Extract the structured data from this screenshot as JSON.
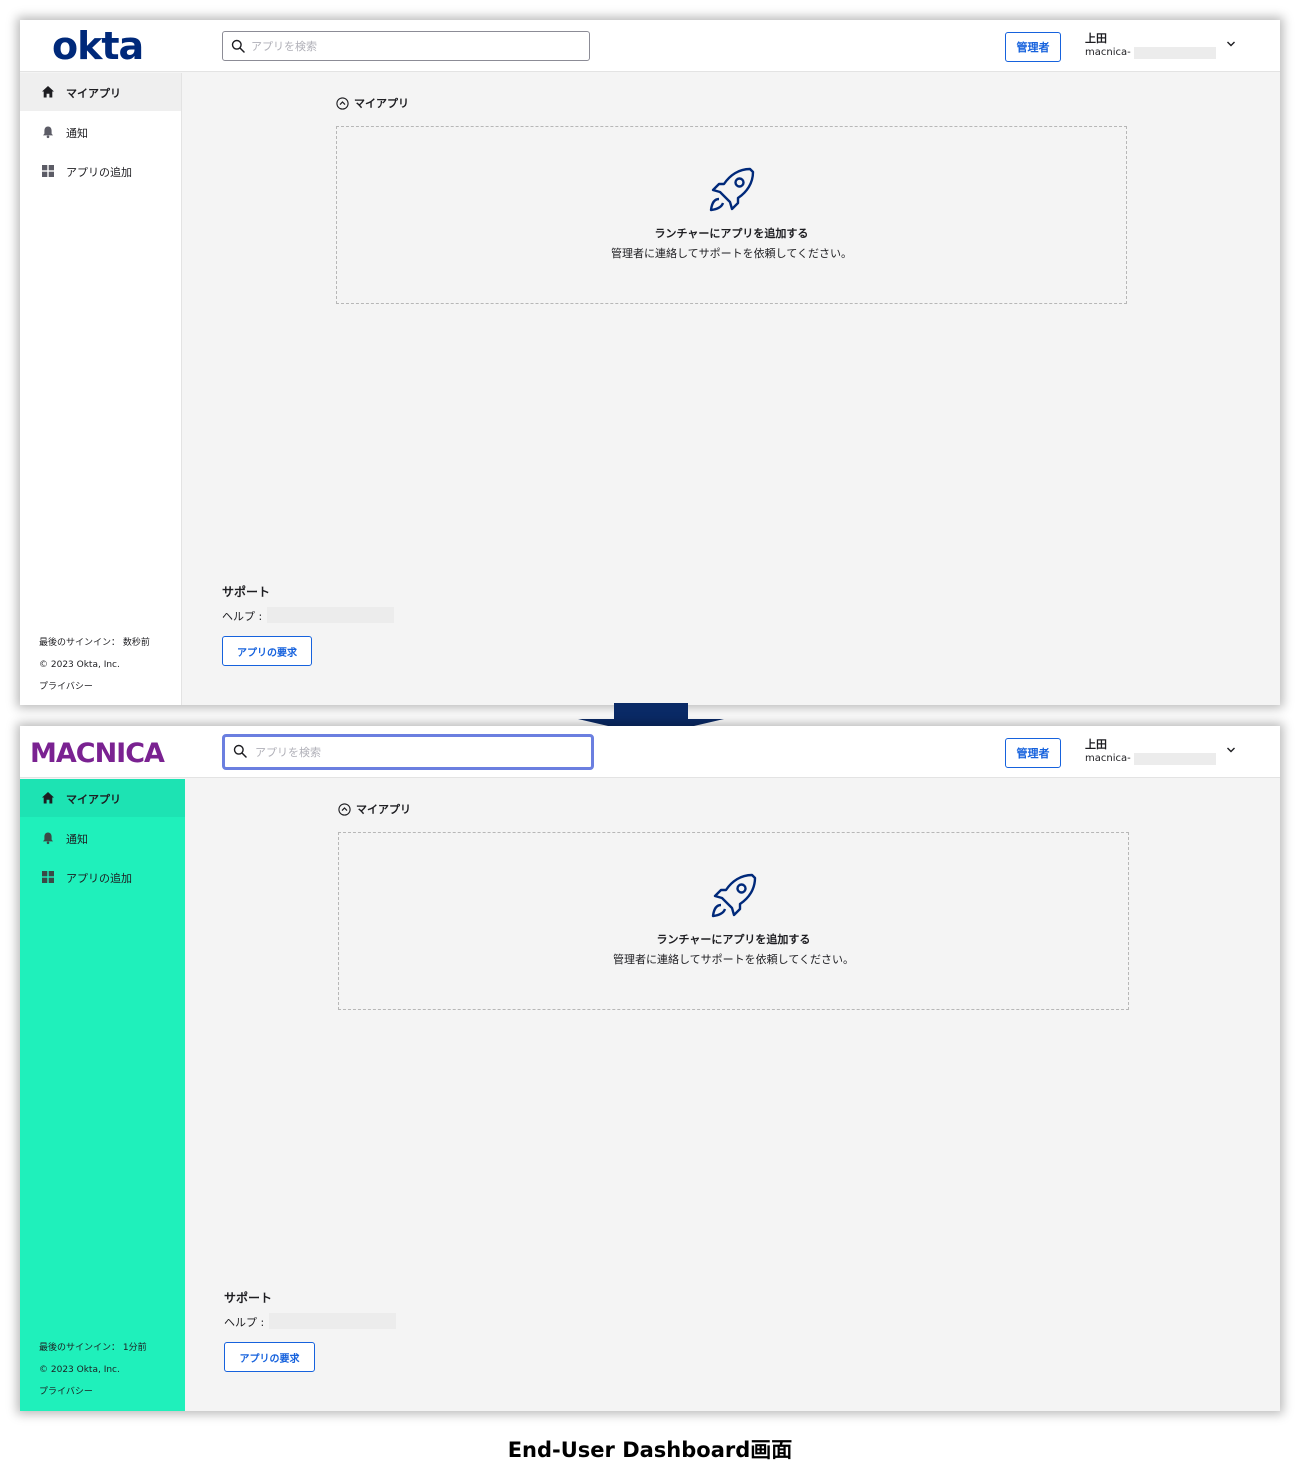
{
  "top": {
    "logo_text": "okta",
    "search": {
      "placeholder": "アプリを検索"
    },
    "admin_button": "管理者",
    "user": {
      "name": "上田",
      "org": "macnica-"
    },
    "sidebar": {
      "items": [
        {
          "label": "マイアプリ",
          "icon": "home-icon",
          "active": true
        },
        {
          "label": "通知",
          "icon": "bell-icon"
        },
        {
          "label": "アプリの追加",
          "icon": "grid-icon"
        }
      ],
      "footer": {
        "last_signin": "最後のサインイン： 数秒前",
        "copyright": "© 2023 Okta, Inc.",
        "privacy": "プライバシー"
      }
    },
    "section_label": "マイアプリ",
    "empty_state": {
      "title": "ランチャーにアプリを追加する",
      "subtitle": "管理者に連絡してサポートを依頼してください。"
    },
    "support": {
      "title": "サポート",
      "help_label": "ヘルプ :",
      "request_button": "アプリの要求"
    }
  },
  "bottom": {
    "logo_text": "MACNICA",
    "search": {
      "placeholder": "アプリを検索"
    },
    "admin_button": "管理者",
    "user": {
      "name": "上田",
      "org": "macnica-"
    },
    "sidebar": {
      "items": [
        {
          "label": "マイアプリ",
          "icon": "home-icon",
          "active": true
        },
        {
          "label": "通知",
          "icon": "bell-icon"
        },
        {
          "label": "アプリの追加",
          "icon": "grid-icon"
        }
      ],
      "footer": {
        "last_signin": "最後のサインイン： 1分前",
        "copyright": "© 2023 Okta, Inc.",
        "privacy": "プライバシー"
      }
    },
    "section_label": "マイアプリ",
    "empty_state": {
      "title": "ランチャーにアプリを追加する",
      "subtitle": "管理者に連絡してサポートを依頼してください。"
    },
    "support": {
      "title": "サポート",
      "help_label": "ヘルプ :",
      "request_button": "アプリの要求"
    }
  },
  "colors": {
    "okta_navy": "#00297a",
    "macnica_purple": "#7a2291",
    "teal_sidebar": "#1ff0bb",
    "link_blue": "#1662dd",
    "focus_ring": "#6b7fe0",
    "arrow_navy": "#0a2a66"
  },
  "caption": "End-User Dashboard画面"
}
